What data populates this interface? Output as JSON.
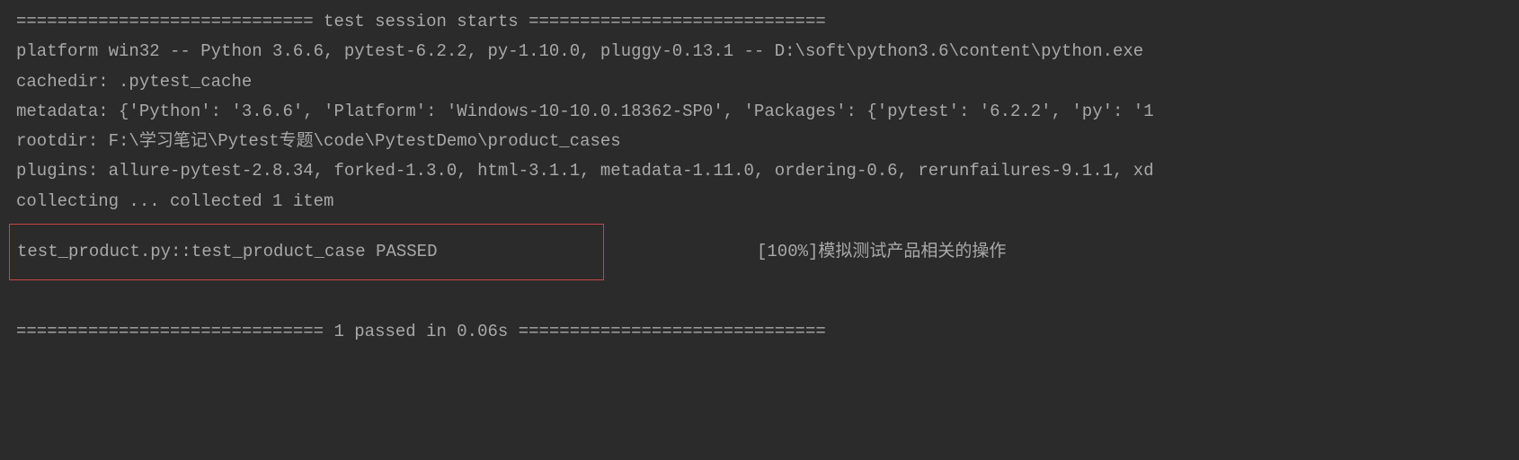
{
  "session": {
    "header": "============================= test session starts =============================",
    "platform": "platform win32 -- Python 3.6.6, pytest-6.2.2, py-1.10.0, pluggy-0.13.1 -- D:\\soft\\python3.6\\content\\python.exe",
    "cachedir": "cachedir: .pytest_cache",
    "metadata": "metadata: {'Python': '3.6.6', 'Platform': 'Windows-10-10.0.18362-SP0', 'Packages': {'pytest': '6.2.2', 'py': '1",
    "rootdir": "rootdir: F:\\学习笔记\\Pytest专题\\code\\PytestDemo\\product_cases",
    "plugins": "plugins: allure-pytest-2.8.34, forked-1.3.0, html-3.1.1, metadata-1.11.0, ordering-0.6, rerunfailures-9.1.1, xd",
    "collecting": "collecting ... collected 1 item",
    "test_result": "test_product.py::test_product_case PASSED",
    "progress_msg": "[100%]模拟测试产品相关的操作",
    "footer": "============================== 1 passed in 0.06s =============================="
  }
}
